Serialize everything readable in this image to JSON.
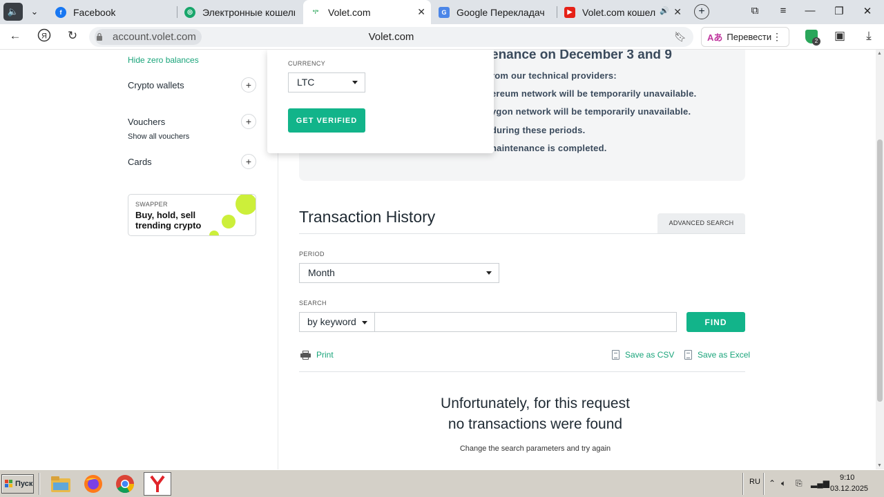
{
  "browser": {
    "tabs": [
      {
        "title": "Facebook",
        "icon": "facebook-icon",
        "color": "#1877f2",
        "active": false
      },
      {
        "title": "Электронные кошельки V",
        "icon": "wallet-site-icon",
        "color": "#18a66b",
        "active": false
      },
      {
        "title": "Volet.com",
        "icon": "volet-icon",
        "color": "#2aa65a",
        "active": true
      },
      {
        "title": "Google Перекладач",
        "icon": "google-translate-icon",
        "color": "#4b86e8",
        "active": false
      },
      {
        "title": "Volet.com кошелек",
        "icon": "youtube-icon",
        "color": "#e62117",
        "active": false
      }
    ],
    "url_domain": "account.volet.com",
    "page_title": "Volet.com",
    "translate_label": "Перевести",
    "shield_count": "2"
  },
  "sidebar": {
    "hide_zero_balances": "Hide zero balances",
    "crypto_wallets": "Crypto wallets",
    "vouchers": "Vouchers",
    "show_all_vouchers": "Show all vouchers",
    "cards": "Cards",
    "swapper": {
      "kicker": "SWAPPER",
      "headline": "Buy, hold, sell trending crypto"
    }
  },
  "popup": {
    "currency_label": "CURRENCY",
    "currency_value": "LTC",
    "verify_button": "GET VERIFIED"
  },
  "notice": {
    "title": "enance on December 3 and 9",
    "lines": [
      "rom our technical providers:",
      "ereum network will be temporarily unavailable.",
      "ygon network will be temporarily unavailable.",
      "during these periods.",
      "naintenance is completed."
    ]
  },
  "history": {
    "title": "Transaction History",
    "advanced_search": "ADVANCED SEARCH",
    "period_label": "PERIOD",
    "period_value": "Month",
    "search_label": "SEARCH",
    "search_mode": "by keyword",
    "search_value": "",
    "find_button": "FIND",
    "print": "Print",
    "save_csv": "Save as CSV",
    "save_excel": "Save as Excel",
    "empty_line1": "Unfortunately, for this request",
    "empty_line2": "no transactions were found",
    "empty_hint": "Change the search parameters and try again"
  },
  "taskbar": {
    "start_label": "Пуск",
    "language": "RU",
    "time": "9:10",
    "date": "03.12.2025"
  },
  "colors": {
    "accent_green": "#12b48a",
    "link_green": "#19a47a",
    "swapper_lime": "#ccef3a"
  }
}
